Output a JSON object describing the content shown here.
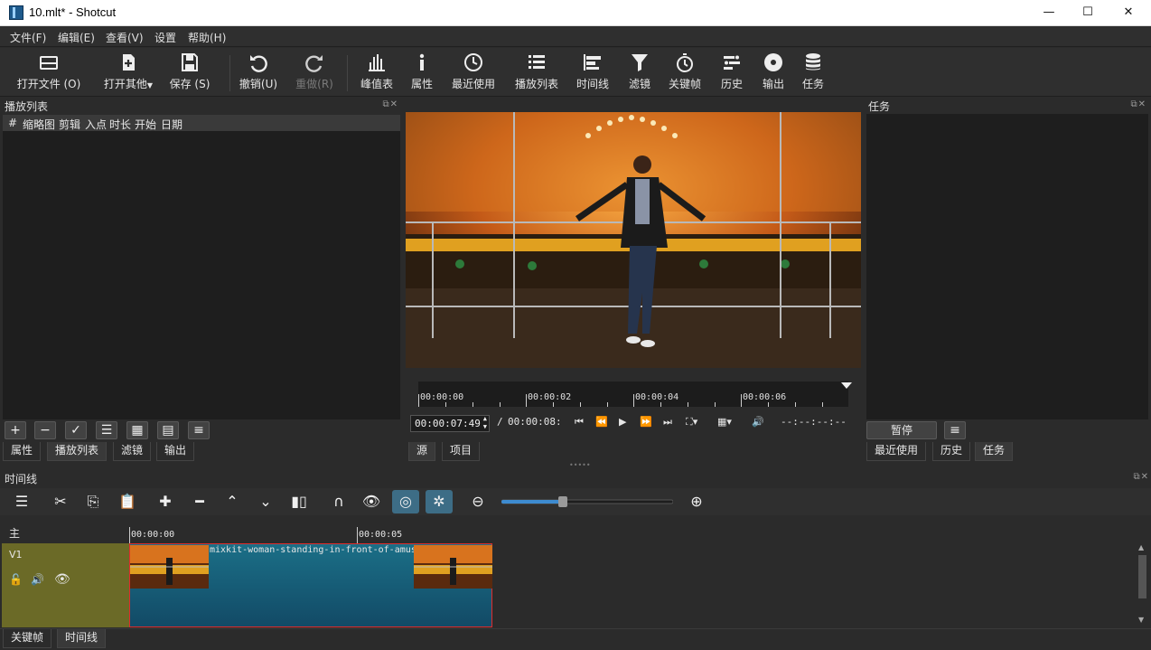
{
  "window": {
    "title": "10.mlt* - Shotcut",
    "minimize": "—",
    "maximize": "☐",
    "close": "✕"
  },
  "menu": [
    "文件(F)",
    "编辑(E)",
    "查看(V)",
    "设置",
    "帮助(H)"
  ],
  "toolbar": {
    "open_file": "打开文件 (O)",
    "open_other": "打开其他",
    "save": "保存 (S)",
    "undo": "撤销(U)",
    "redo": "重做(R)",
    "peak_meter": "峰值表",
    "properties": "属性",
    "recent": "最近使用",
    "playlist": "播放列表",
    "timeline": "时间线",
    "filters": "滤镜",
    "keyframes": "关键帧",
    "history": "历史",
    "export": "输出",
    "jobs": "任务"
  },
  "playlist_panel": {
    "title": "播放列表",
    "columns": [
      "#",
      "缩略图",
      "剪辑",
      "入点",
      "时长",
      "开始",
      "日期"
    ],
    "tabs": [
      "属性",
      "播放列表",
      "滤镜",
      "输出"
    ]
  },
  "viewer": {
    "ruler_labels": [
      "00:00:00",
      "00:00:02",
      "00:00:04",
      "00:00:06"
    ],
    "current_time": "00:00:07:49",
    "separator": "/",
    "total_time": "00:00:08:",
    "inout": "--:--:--:--",
    "tabs": [
      "源",
      "项目"
    ]
  },
  "jobs_panel": {
    "title": "任务",
    "pause": "暂停",
    "tabs": [
      "最近使用",
      "历史",
      "任务"
    ]
  },
  "timeline_panel": {
    "title": "时间线",
    "master_label": "主",
    "track_v1": "V1",
    "ruler_labels": [
      "00:00:00",
      "00:00:05"
    ],
    "clip_name": "mixkit-woman-standing-in-front-of-amusement-park-ride",
    "zoom_level": 0.35
  },
  "bottom_tabs": [
    "关键帧",
    "时间线"
  ],
  "colors": {
    "accent": "#3d6d86",
    "track_header": "#6b6a27",
    "clip": "#1b6f87",
    "clip_border": "#e02c2c"
  }
}
